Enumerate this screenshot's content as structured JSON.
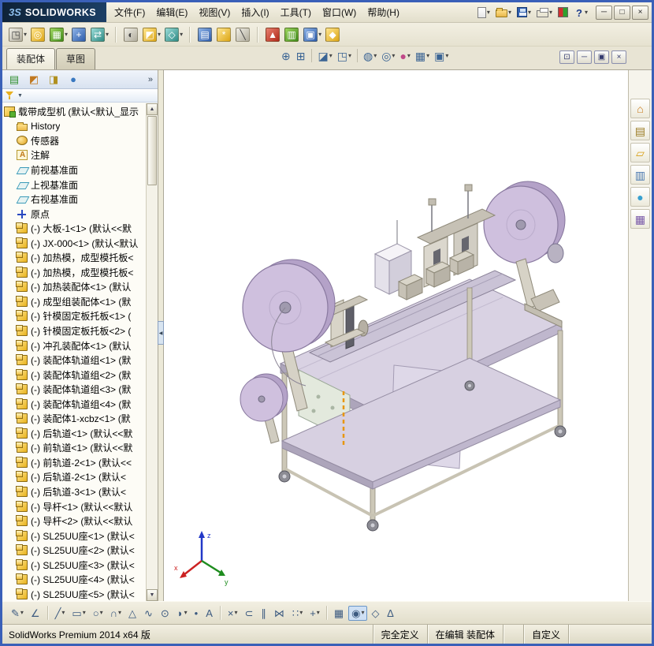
{
  "title_bar": {
    "brand_mark": "3S",
    "brand_name": "SOLIDWORKS",
    "menus": [
      "文件(F)",
      "编辑(E)",
      "视图(V)",
      "插入(I)",
      "工具(T)",
      "窗口(W)",
      "帮助(H)"
    ],
    "quick_icons": [
      {
        "name": "new-document-button",
        "icon": "new-document",
        "dd": "▾"
      },
      {
        "name": "open-button",
        "icon": "open-folder",
        "dd": "▾"
      },
      {
        "name": "save-button",
        "icon": "save",
        "dd": "▾"
      },
      {
        "name": "print-button",
        "icon": "print",
        "dd": "▾"
      },
      {
        "name": "color-swatch-button",
        "icon": "color-swatch",
        "dd": ""
      },
      {
        "name": "help-button",
        "icon": "help",
        "dd": "▾"
      }
    ],
    "window_buttons": [
      {
        "name": "minimize-button",
        "glyph": "─"
      },
      {
        "name": "maximize-button",
        "glyph": "□"
      },
      {
        "name": "close-button",
        "glyph": "×"
      }
    ]
  },
  "toolbar": {
    "items": [
      {
        "name": "insert-components-button",
        "color": "c-grey",
        "glyph": "◳",
        "dd": "▾"
      },
      {
        "name": "mate-button",
        "color": "c-yellow",
        "glyph": "◎",
        "dd": ""
      },
      {
        "name": "linear-component-pattern-button",
        "color": "c-green",
        "glyph": "▦",
        "dd": "▾"
      },
      {
        "name": "smart-fasteners-button",
        "color": "c-blue",
        "glyph": "+",
        "dd": ""
      },
      {
        "name": "move-component-button",
        "color": "c-teal",
        "glyph": "⇄",
        "dd": "▾"
      },
      {
        "name": "separator",
        "color": "sep",
        "glyph": "",
        "dd": ""
      },
      {
        "name": "show-hidden-components-button",
        "color": "c-grey",
        "glyph": "◐",
        "dd": ""
      },
      {
        "name": "assembly-features-button",
        "color": "c-yellow",
        "glyph": "◩",
        "dd": "▾"
      },
      {
        "name": "reference-geometry-button",
        "color": "c-teal",
        "glyph": "◇",
        "dd": "▾"
      },
      {
        "name": "separator",
        "color": "sep",
        "glyph": "",
        "dd": ""
      },
      {
        "name": "bill-of-materials-button",
        "color": "c-blue",
        "glyph": "▤",
        "dd": ""
      },
      {
        "name": "exploded-view-button",
        "color": "c-yellow",
        "glyph": "*",
        "dd": ""
      },
      {
        "name": "explode-line-sketch-button",
        "color": "c-grey",
        "glyph": "╲",
        "dd": ""
      },
      {
        "name": "separator",
        "color": "sep",
        "glyph": "",
        "dd": ""
      },
      {
        "name": "interference-detection-button",
        "color": "c-red",
        "glyph": "▲",
        "dd": ""
      },
      {
        "name": "assembly-visualization-button",
        "color": "c-green",
        "glyph": "▥",
        "dd": ""
      },
      {
        "name": "motion-study-button",
        "color": "c-blue",
        "glyph": "▣",
        "dd": "▾"
      },
      {
        "name": "instant-3d-button",
        "color": "c-yellow",
        "glyph": "◆",
        "dd": ""
      }
    ]
  },
  "tabs": [
    {
      "name": "tab-assembly",
      "label": "装配体",
      "cls": "active"
    },
    {
      "name": "tab-sketch",
      "label": "草图",
      "cls": ""
    }
  ],
  "hud": [
    {
      "name": "zoom-to-fit-button",
      "glyph": "⊕",
      "dd": "",
      "cls": ""
    },
    {
      "name": "zoom-to-area-button",
      "glyph": "⊞",
      "dd": "",
      "cls": ""
    },
    {
      "name": "separator",
      "glyph": "",
      "dd": "",
      "cls": "sep"
    },
    {
      "name": "section-view-button",
      "glyph": "◪",
      "dd": "▾",
      "cls": ""
    },
    {
      "name": "view-orientation-button",
      "glyph": "◳",
      "dd": "▾",
      "cls": ""
    },
    {
      "name": "separator",
      "glyph": "",
      "dd": "",
      "cls": "sep"
    },
    {
      "name": "display-style-button",
      "glyph": "◍",
      "dd": "▾",
      "cls": ""
    },
    {
      "name": "hide-show-items-button",
      "glyph": "◎",
      "dd": "▾",
      "cls": ""
    },
    {
      "name": "edit-appearance-button",
      "glyph": "●",
      "dd": "▾",
      "cls": "ball"
    },
    {
      "name": "apply-scene-button",
      "glyph": "▦",
      "dd": "▾",
      "cls": ""
    },
    {
      "name": "view-settings-button",
      "glyph": "▣",
      "dd": "▾",
      "cls": ""
    }
  ],
  "doc_buttons": [
    {
      "name": "doc-pin-button",
      "glyph": "⊡"
    },
    {
      "name": "doc-minimize-button",
      "glyph": "─"
    },
    {
      "name": "doc-restore-button",
      "glyph": "▣"
    },
    {
      "name": "doc-close-button",
      "glyph": "×"
    }
  ],
  "panel": {
    "header_icons": [
      {
        "name": "featuremanager-tree-tab",
        "glyph": "▤",
        "style": "color:#2f8f2f"
      },
      {
        "name": "propertymanager-tab",
        "glyph": "◩",
        "style": "color:#c07820"
      },
      {
        "name": "configurationmanager-tab",
        "glyph": "◨",
        "style": "color:#b09020"
      },
      {
        "name": "displaymanager-tab",
        "glyph": "●",
        "style": "color:#3878c0"
      }
    ],
    "expand_label": "»",
    "filter_arrow": "▼",
    "scroll_up_glyph": "▲",
    "scroll_down_glyph": "▼",
    "collapse_glyph": "◀"
  },
  "tree": [
    {
      "icon_cls": "ti-root",
      "icon_name": "assembly-icon",
      "indent_cls": "ind0",
      "label": "载带成型机 (默认<默认_显示"
    },
    {
      "icon_cls": "ti-hist",
      "icon_name": "history-folder-icon",
      "indent_cls": "ind1",
      "label": "History"
    },
    {
      "icon_cls": "ti-sensor",
      "icon_name": "sensors-folder-icon",
      "indent_cls": "ind1",
      "label": "传感器"
    },
    {
      "icon_cls": "ti-ann",
      "icon_name": "annotations-icon",
      "indent_cls": "ind1",
      "label": "注解"
    },
    {
      "icon_cls": "ti-plane",
      "icon_name": "plane-icon",
      "indent_cls": "ind1",
      "label": "前视基准面"
    },
    {
      "icon_cls": "ti-plane",
      "icon_name": "plane-icon",
      "indent_cls": "ind1",
      "label": "上视基准面"
    },
    {
      "icon_cls": "ti-plane",
      "icon_name": "plane-icon",
      "indent_cls": "ind1",
      "label": "右视基准面"
    },
    {
      "icon_cls": "ti-origin",
      "icon_name": "origin-icon",
      "indent_cls": "ind1",
      "label": "原点"
    },
    {
      "icon_cls": "ti-comp",
      "icon_name": "component-icon",
      "indent_cls": "ind1",
      "label": "(-) 大板-1<1> (默认<<默"
    },
    {
      "icon_cls": "ti-comp",
      "icon_name": "component-icon",
      "indent_cls": "ind1",
      "label": "(-) JX-000<1> (默认<默认"
    },
    {
      "icon_cls": "ti-comp",
      "icon_name": "component-icon",
      "indent_cls": "ind1",
      "label": "(-) 加热模，成型模托板<"
    },
    {
      "icon_cls": "ti-comp",
      "icon_name": "component-icon",
      "indent_cls": "ind1",
      "label": "(-) 加热模，成型模托板<"
    },
    {
      "icon_cls": "ti-comp",
      "icon_name": "component-icon",
      "indent_cls": "ind1",
      "label": "(-) 加热装配体<1> (默认"
    },
    {
      "icon_cls": "ti-comp",
      "icon_name": "component-icon",
      "indent_cls": "ind1",
      "label": "(-) 成型组装配体<1> (默"
    },
    {
      "icon_cls": "ti-comp",
      "icon_name": "component-icon",
      "indent_cls": "ind1",
      "label": "(-) 针模固定板托板<1> ("
    },
    {
      "icon_cls": "ti-comp",
      "icon_name": "component-icon",
      "indent_cls": "ind1",
      "label": "(-) 针模固定板托板<2> ("
    },
    {
      "icon_cls": "ti-comp",
      "icon_name": "component-icon",
      "indent_cls": "ind1",
      "label": "(-) 冲孔装配体<1> (默认"
    },
    {
      "icon_cls": "ti-comp",
      "icon_name": "component-icon",
      "indent_cls": "ind1",
      "label": "(-) 装配体轨道组<1> (默"
    },
    {
      "icon_cls": "ti-comp",
      "icon_name": "component-icon",
      "indent_cls": "ind1",
      "label": "(-) 装配体轨道组<2> (默"
    },
    {
      "icon_cls": "ti-comp",
      "icon_name": "component-icon",
      "indent_cls": "ind1",
      "label": "(-) 装配体轨道组<3> (默"
    },
    {
      "icon_cls": "ti-comp",
      "icon_name": "component-icon",
      "indent_cls": "ind1",
      "label": "(-) 装配体轨道组<4> (默"
    },
    {
      "icon_cls": "ti-comp",
      "icon_name": "component-icon",
      "indent_cls": "ind1",
      "label": "(-) 装配体1-xcbz<1> (默"
    },
    {
      "icon_cls": "ti-comp",
      "icon_name": "component-icon",
      "indent_cls": "ind1",
      "label": "(-) 后轨道<1> (默认<<默"
    },
    {
      "icon_cls": "ti-comp",
      "icon_name": "component-icon",
      "indent_cls": "ind1",
      "label": "(-) 前轨道<1> (默认<<默"
    },
    {
      "icon_cls": "ti-comp",
      "icon_name": "component-icon",
      "indent_cls": "ind1",
      "label": "(-) 前轨道-2<1> (默认<<"
    },
    {
      "icon_cls": "ti-comp",
      "icon_name": "component-icon",
      "indent_cls": "ind1",
      "label": "(-) 后轨道-2<1> (默认<"
    },
    {
      "icon_cls": "ti-comp",
      "icon_name": "component-icon",
      "indent_cls": "ind1",
      "label": "(-) 后轨道-3<1> (默认<"
    },
    {
      "icon_cls": "ti-comp",
      "icon_name": "component-icon",
      "indent_cls": "ind1",
      "label": "(-) 导杆<1> (默认<<默认"
    },
    {
      "icon_cls": "ti-comp",
      "icon_name": "component-icon",
      "indent_cls": "ind1",
      "label": "(-) 导杆<2> (默认<<默认"
    },
    {
      "icon_cls": "ti-comp",
      "icon_name": "component-icon",
      "indent_cls": "ind1",
      "label": "(-) SL25UU座<1> (默认<"
    },
    {
      "icon_cls": "ti-comp",
      "icon_name": "component-icon",
      "indent_cls": "ind1",
      "label": "(-) SL25UU座<2> (默认<"
    },
    {
      "icon_cls": "ti-comp",
      "icon_name": "component-icon",
      "indent_cls": "ind1",
      "label": "(-) SL25UU座<3> (默认<"
    },
    {
      "icon_cls": "ti-comp",
      "icon_name": "component-icon",
      "indent_cls": "ind1",
      "label": "(-) SL25UU座<4> (默认<"
    },
    {
      "icon_cls": "ti-comp",
      "icon_name": "component-icon",
      "indent_cls": "ind1",
      "label": "(-) SL25UU座<5> (默认<"
    }
  ],
  "task_pane": [
    {
      "name": "solidworks-resources-tab",
      "glyph": "⌂",
      "style": "color:#c87818"
    },
    {
      "name": "design-library-tab",
      "glyph": "▤",
      "style": "color:#9a7a20"
    },
    {
      "name": "file-explorer-tab",
      "glyph": "▱",
      "style": "color:#d8a018"
    },
    {
      "name": "view-palette-tab",
      "glyph": "▥",
      "style": "color:#4a78b0"
    },
    {
      "name": "appearances-tab",
      "glyph": "●",
      "style": "color:#38a0d0"
    },
    {
      "name": "custom-properties-tab",
      "glyph": "▦",
      "style": "color:#7858a8"
    }
  ],
  "bottom_toolbar": [
    {
      "name": "sketch-button",
      "glyph": "✎",
      "dd": "▾",
      "cls": ""
    },
    {
      "name": "smart-dimension-button",
      "glyph": "∠",
      "dd": "",
      "cls": ""
    },
    {
      "name": "separator",
      "glyph": "",
      "dd": "",
      "cls": "sep"
    },
    {
      "name": "line-button",
      "glyph": "╱",
      "dd": "▾",
      "cls": ""
    },
    {
      "name": "rectangle-button",
      "glyph": "▭",
      "dd": "▾",
      "cls": ""
    },
    {
      "name": "circle-button",
      "glyph": "○",
      "dd": "▾",
      "cls": ""
    },
    {
      "name": "arc-button",
      "glyph": "∩",
      "dd": "▾",
      "cls": ""
    },
    {
      "name": "polygon-button",
      "glyph": "△",
      "dd": "",
      "cls": ""
    },
    {
      "name": "spline-button",
      "glyph": "∿",
      "dd": "",
      "cls": ""
    },
    {
      "name": "ellipse-button",
      "glyph": "⊙",
      "dd": "",
      "cls": ""
    },
    {
      "name": "sketch-fillet-button",
      "glyph": "◗",
      "dd": "▾",
      "cls": ""
    },
    {
      "name": "point-button",
      "glyph": "•",
      "dd": "",
      "cls": ""
    },
    {
      "name": "text-button",
      "glyph": "A",
      "dd": "",
      "cls": ""
    },
    {
      "name": "separator",
      "glyph": "",
      "dd": "",
      "cls": "sep"
    },
    {
      "name": "trim-entities-button",
      "glyph": "×",
      "dd": "▾",
      "cls": ""
    },
    {
      "name": "convert-entities-button",
      "glyph": "⊂",
      "dd": "",
      "cls": ""
    },
    {
      "name": "offset-entities-button",
      "glyph": "∥",
      "dd": "",
      "cls": ""
    },
    {
      "name": "mirror-entities-button",
      "glyph": "⋈",
      "dd": "",
      "cls": ""
    },
    {
      "name": "linear-sketch-pattern-button",
      "glyph": "∷",
      "dd": "▾",
      "cls": ""
    },
    {
      "name": "move-entities-button",
      "glyph": "+",
      "dd": "▾",
      "cls": ""
    },
    {
      "name": "separator",
      "glyph": "",
      "dd": "",
      "cls": "sep"
    },
    {
      "name": "display-grid-button",
      "glyph": "▦",
      "dd": "",
      "cls": ""
    },
    {
      "name": "sketch-snaps-button",
      "glyph": "◉",
      "dd": "▾",
      "cls": "active"
    },
    {
      "name": "rapid-sketch-button",
      "glyph": "◇",
      "dd": "",
      "cls": ""
    },
    {
      "name": "instant-2d-button",
      "glyph": "∆",
      "dd": "",
      "cls": ""
    }
  ],
  "status_bar": {
    "left": "SolidWorks Premium 2014 x64 版",
    "cells": [
      {
        "label": "完全定义",
        "cls": ""
      },
      {
        "label": "在编辑 装配体",
        "cls": ""
      },
      {
        "label": "",
        "cls": "sc-spacer-sm"
      },
      {
        "label": "自定义",
        "cls": ""
      },
      {
        "label": "",
        "cls": "sc-spacer-lg"
      }
    ]
  },
  "viewport": {
    "triad": {
      "x": "x",
      "y": "y",
      "z": "z"
    }
  }
}
